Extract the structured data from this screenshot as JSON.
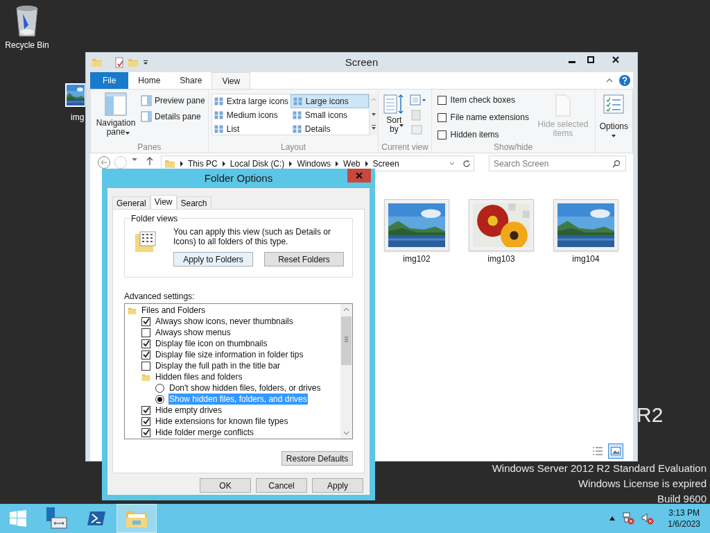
{
  "desktop": {
    "icons": [
      {
        "label": "Recycle Bin",
        "kind": "recycle_bin"
      },
      {
        "label": "img",
        "kind": "picture"
      }
    ],
    "edition_fragment": "R2",
    "edition_lines": [
      "Windows Server 2012 R2 Standard Evaluation",
      "Windows License is expired",
      "Build 9600"
    ]
  },
  "explorer": {
    "title": "Screen",
    "ribbon_tabs": [
      {
        "label": "File",
        "kind": "file",
        "selected": false
      },
      {
        "label": "Home",
        "kind": "tab",
        "selected": false
      },
      {
        "label": "Share",
        "kind": "tab",
        "selected": false
      },
      {
        "label": "View",
        "kind": "tab",
        "selected": true
      }
    ],
    "panes": {
      "caption": "Panes",
      "big": "Navigation pane",
      "items": [
        "Preview pane",
        "Details pane"
      ]
    },
    "layout": {
      "caption": "Layout",
      "items": [
        {
          "label": "Extra large icons",
          "selected": false
        },
        {
          "label": "Large icons",
          "selected": true
        },
        {
          "label": "Medium icons",
          "selected": false
        },
        {
          "label": "Small icons",
          "selected": false
        },
        {
          "label": "List",
          "selected": false
        },
        {
          "label": "Details",
          "selected": false
        }
      ]
    },
    "current_view": {
      "caption": "Current view",
      "sort": "Sort by"
    },
    "show_hide": {
      "caption": "Show/hide",
      "checkboxes": [
        {
          "label": "Item check boxes",
          "checked": false
        },
        {
          "label": "File name extensions",
          "checked": false
        },
        {
          "label": "Hidden items",
          "checked": false
        }
      ],
      "hide_selected": {
        "label": "Hide selected items",
        "disabled": true
      }
    },
    "options": "Options",
    "breadcrumb": [
      "This PC",
      "Local Disk (C:)",
      "Windows",
      "Web",
      "Screen"
    ],
    "search_placeholder": "Search Screen",
    "files": [
      {
        "name": "img102",
        "kind": "picture"
      },
      {
        "name": "img103",
        "kind": "picture"
      },
      {
        "name": "img104",
        "kind": "picture"
      }
    ],
    "view_toggles": [
      {
        "kind": "details",
        "selected": false
      },
      {
        "kind": "large_icons",
        "selected": true
      }
    ]
  },
  "folder_options": {
    "title": "Folder Options",
    "tabs": [
      {
        "label": "General",
        "selected": false
      },
      {
        "label": "View",
        "selected": true
      },
      {
        "label": "Search",
        "selected": false
      }
    ],
    "folder_views": {
      "legend": "Folder views",
      "text": "You can apply this view (such as Details or Icons) to all folders of this type.",
      "buttons": [
        "Apply to Folders",
        "Reset Folders"
      ]
    },
    "advanced_label": "Advanced settings:",
    "tree": [
      {
        "kind": "folder",
        "label": "Files and Folders",
        "selected": false,
        "children": [
          {
            "kind": "checkbox",
            "label": "Always show icons, never thumbnails",
            "checked": true,
            "selected": false
          },
          {
            "kind": "checkbox",
            "label": "Always show menus",
            "checked": false,
            "selected": false
          },
          {
            "kind": "checkbox",
            "label": "Display file icon on thumbnails",
            "checked": true,
            "selected": false
          },
          {
            "kind": "checkbox",
            "label": "Display file size information in folder tips",
            "checked": true,
            "selected": false
          },
          {
            "kind": "checkbox",
            "label": "Display the full path in the title bar",
            "checked": false,
            "selected": false
          },
          {
            "kind": "folder",
            "label": "Hidden files and folders",
            "selected": false,
            "children": [
              {
                "kind": "radio",
                "label": "Don't show hidden files, folders, or drives",
                "checked": false,
                "selected": false
              },
              {
                "kind": "radio",
                "label": "Show hidden files, folders, and drives",
                "checked": true,
                "selected": true
              }
            ]
          },
          {
            "kind": "checkbox",
            "label": "Hide empty drives",
            "checked": true,
            "selected": false
          },
          {
            "kind": "checkbox",
            "label": "Hide extensions for known file types",
            "checked": true,
            "selected": false
          },
          {
            "kind": "checkbox",
            "label": "Hide folder merge conflicts",
            "checked": true,
            "selected": false
          }
        ]
      }
    ],
    "restore_button": "Restore Defaults",
    "buttons": [
      "OK",
      "Cancel",
      "Apply"
    ]
  },
  "taskbar": {
    "items": [
      {
        "kind": "server_manager",
        "active": false
      },
      {
        "kind": "powershell",
        "active": false
      },
      {
        "kind": "explorer",
        "active": true
      }
    ],
    "time": "3:13 PM",
    "date": "1/6/2023"
  }
}
